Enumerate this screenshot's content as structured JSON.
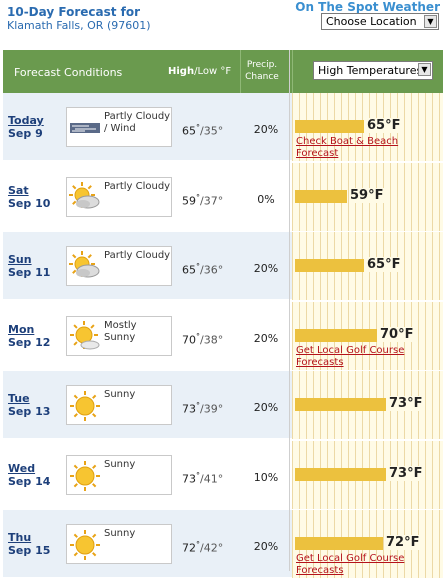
{
  "header": {
    "title": "10-Day Forecast for",
    "location": "Klamath Falls, OR (97601)",
    "spot_title": "On The Spot Weather",
    "location_select": "Choose Location"
  },
  "table_header": {
    "conditions": "Forecast Conditions",
    "high": "High",
    "low": "/Low °F",
    "precip": "Precip. Chance",
    "chart_select": "High Temperatures"
  },
  "days": [
    {
      "day": "Today",
      "date": "Sep 9",
      "icon": "cloud-wind-icon",
      "condition": "Partly Cloudy / Wind",
      "high": "65",
      "low": "/35°",
      "precip": "20%",
      "high_label": "65°F",
      "high_value": 65,
      "link": "Check Boat & Beach Forecast"
    },
    {
      "day": "Sat",
      "date": "Sep 10",
      "icon": "partly-cloudy-icon",
      "condition": "Partly Cloudy",
      "high": "59",
      "low": "/37°",
      "precip": "0%",
      "high_label": "59°F",
      "high_value": 59,
      "link": ""
    },
    {
      "day": "Sun",
      "date": "Sep 11",
      "icon": "partly-cloudy-icon",
      "condition": "Partly Cloudy",
      "high": "65",
      "low": "/36°",
      "precip": "20%",
      "high_label": "65°F",
      "high_value": 65,
      "link": ""
    },
    {
      "day": "Mon",
      "date": "Sep 12",
      "icon": "mostly-sunny-icon",
      "condition": "Mostly Sunny",
      "high": "70",
      "low": "/38°",
      "precip": "20%",
      "high_label": "70°F",
      "high_value": 70,
      "link": "Get Local Golf Course Forecasts"
    },
    {
      "day": "Tue",
      "date": "Sep 13",
      "icon": "sunny-icon",
      "condition": "Sunny",
      "high": "73",
      "low": "/39°",
      "precip": "20%",
      "high_label": "73°F",
      "high_value": 73,
      "link": ""
    },
    {
      "day": "Wed",
      "date": "Sep 14",
      "icon": "sunny-icon",
      "condition": "Sunny",
      "high": "73",
      "low": "/41°",
      "precip": "10%",
      "high_label": "73°F",
      "high_value": 73,
      "link": ""
    },
    {
      "day": "Thu",
      "date": "Sep 15",
      "icon": "sunny-icon",
      "condition": "Sunny",
      "high": "72",
      "low": "/42°",
      "precip": "20%",
      "high_label": "72°F",
      "high_value": 72,
      "link": "Get Local Golf Course Forecasts"
    }
  ],
  "colors": {
    "header_green": "#6a9a4e",
    "bar_yellow": "#ecc13e",
    "title_blue": "#2a6bb0",
    "link_red": "#b5121b"
  }
}
